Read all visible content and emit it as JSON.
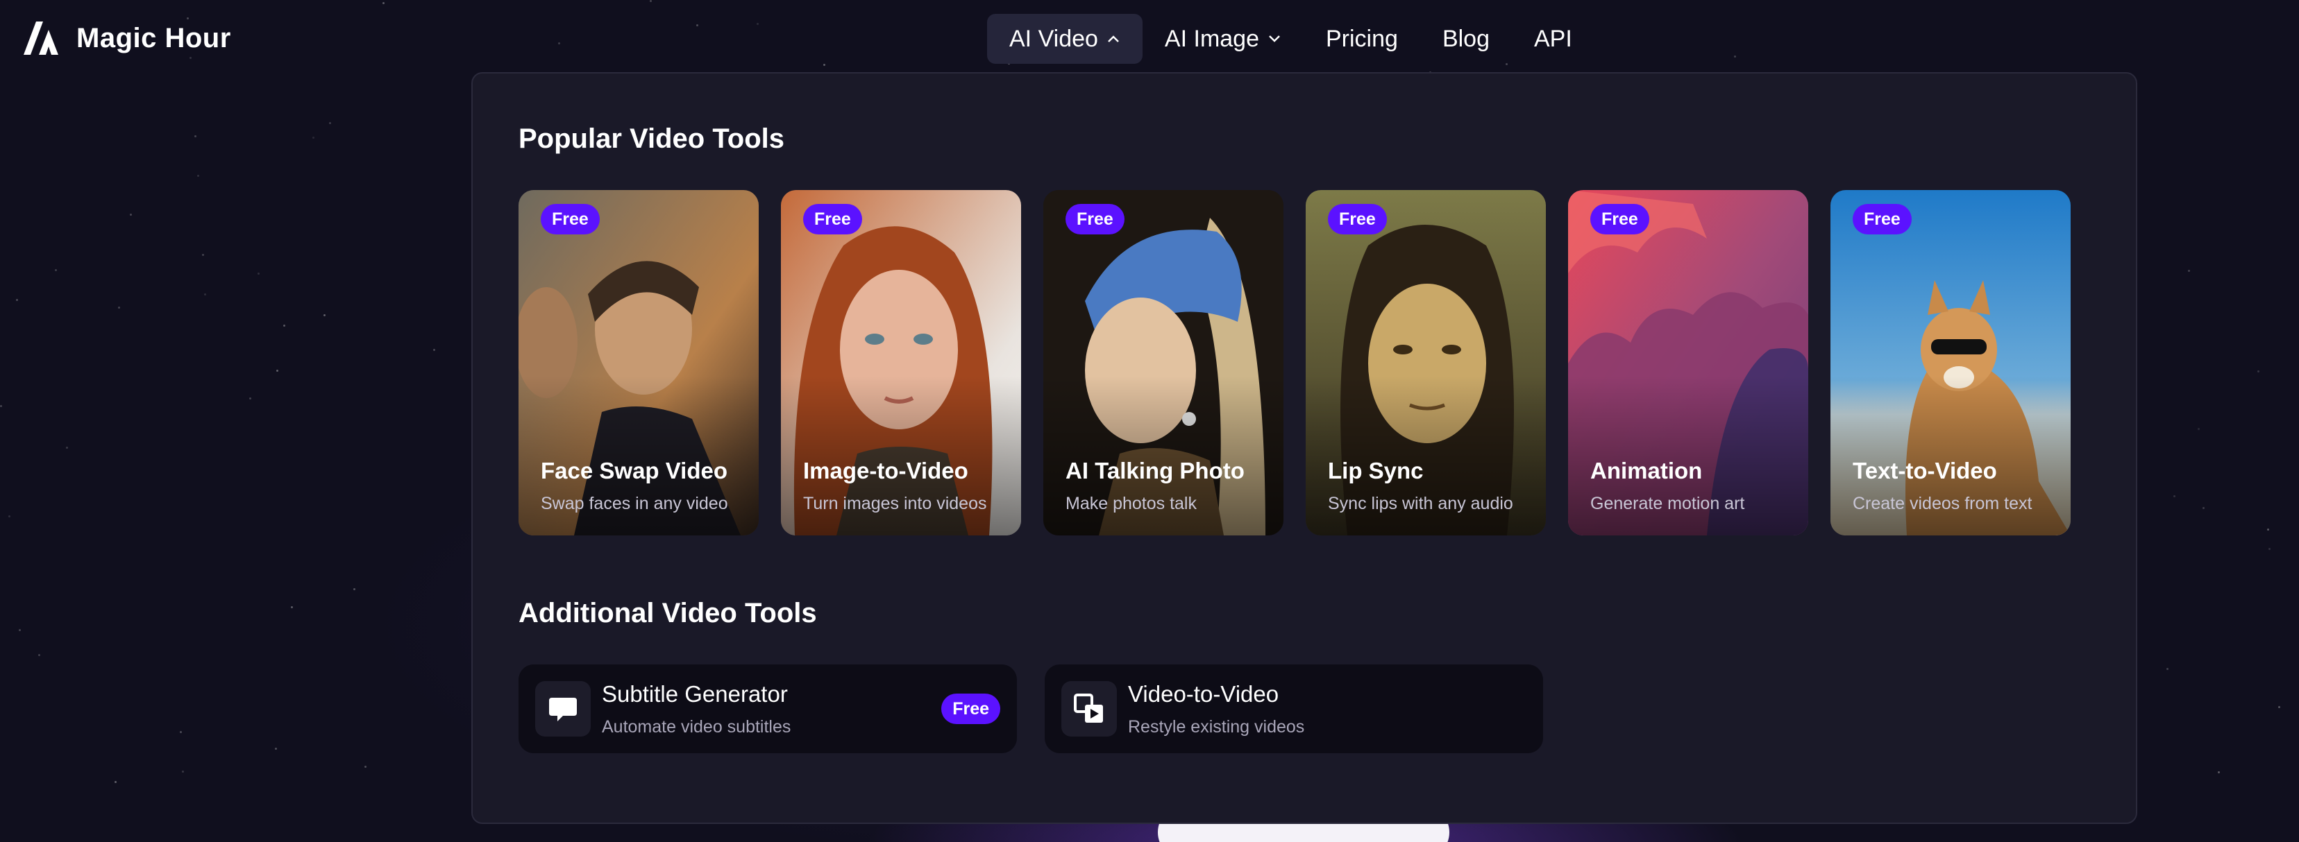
{
  "brand": {
    "name": "Magic Hour"
  },
  "nav": [
    {
      "label": "AI Video",
      "icon": "chevron-up-icon",
      "active": true
    },
    {
      "label": "AI Image",
      "icon": "chevron-down-icon",
      "active": false
    },
    {
      "label": "Pricing"
    },
    {
      "label": "Blog"
    },
    {
      "label": "API"
    }
  ],
  "dropdown": {
    "popular_title": "Popular Video Tools",
    "popular_tools": [
      {
        "badge": "Free",
        "title": "Face Swap Video",
        "subtitle": "Swap faces in any video"
      },
      {
        "badge": "Free",
        "title": "Image-to-Video",
        "subtitle": "Turn images into videos"
      },
      {
        "badge": "Free",
        "title": "AI Talking Photo",
        "subtitle": "Make photos talk"
      },
      {
        "badge": "Free",
        "title": "Lip Sync",
        "subtitle": "Sync lips with any audio"
      },
      {
        "badge": "Free",
        "title": "Animation",
        "subtitle": "Generate motion art"
      },
      {
        "badge": "Free",
        "title": "Text-to-Video",
        "subtitle": "Create videos from text"
      }
    ],
    "additional_title": "Additional Video Tools",
    "additional_tools": [
      {
        "icon": "speech-bubble-icon",
        "title": "Subtitle Generator",
        "subtitle": "Automate video subtitles",
        "badge": "Free"
      },
      {
        "icon": "video-convert-icon",
        "title": "Video-to-Video",
        "subtitle": "Restyle existing videos"
      }
    ]
  },
  "colors": {
    "accent": "#5b12ff",
    "panel": "#1a1928",
    "background": "#100f1e"
  }
}
